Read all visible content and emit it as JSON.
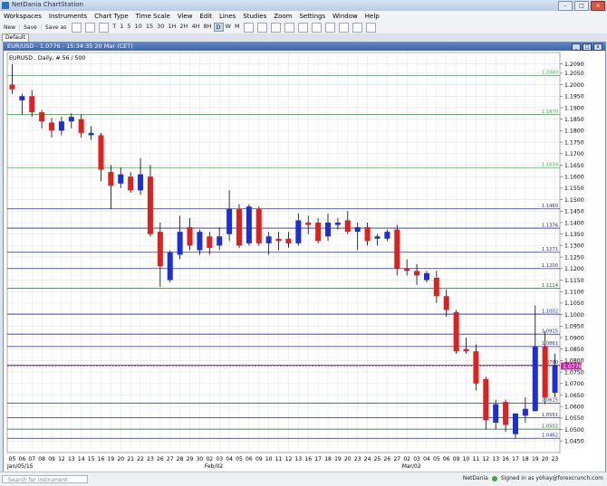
{
  "window": {
    "title": "NetDania ChartStation"
  },
  "menu": [
    "Workspaces",
    "Instruments",
    "Chart Type",
    "Time Scale",
    "View",
    "Edit",
    "Lines",
    "Studies",
    "Zoom",
    "Settings",
    "Window",
    "Help"
  ],
  "toolbar": {
    "new": "New",
    "save": "Save",
    "save_as": "Save as",
    "periods": [
      "T",
      "1",
      "5",
      "10",
      "15",
      "30",
      "1H",
      "2H",
      "4H",
      "8H",
      "D",
      "W",
      "M"
    ],
    "active_period": "D"
  },
  "tab": {
    "label": "Default"
  },
  "chart_window": {
    "title": "EUR/USD - 1.0776 - 15:34:35  20 Mar (CET)"
  },
  "chart_data": {
    "type": "candlestick",
    "label": "EURUSD , Daily, # 56 / 500",
    "ylim": [
      1.04,
      1.214
    ],
    "y_ticks": [
      "1.2090",
      "1.2050",
      "1.2000",
      "1.1950",
      "1.1900",
      "1.1850",
      "1.1800",
      "1.1750",
      "1.1700",
      "1.1650",
      "1.1600",
      "1.1550",
      "1.1500",
      "1.1450",
      "1.1400",
      "1.1350",
      "1.1300",
      "1.1250",
      "1.1200",
      "1.1150",
      "1.1100",
      "1.1050",
      "1.1000",
      "1.0950",
      "1.0900",
      "1.0850",
      "1.0800",
      "1.0750",
      "1.0700",
      "1.0650",
      "1.0600",
      "1.0550",
      "1.0500",
      "1.0450"
    ],
    "x_labels": [
      "05",
      "06",
      "07",
      "08",
      "09",
      "12",
      "13",
      "14",
      "15",
      "16",
      "19",
      "20",
      "21",
      "22",
      "23",
      "26",
      "27",
      "28",
      "29",
      "30",
      "02",
      "03",
      "04",
      "05",
      "06",
      "09",
      "10",
      "11",
      "12",
      "13",
      "16",
      "17",
      "18",
      "19",
      "20",
      "23",
      "24",
      "25",
      "26",
      "27",
      "02",
      "03",
      "04",
      "05",
      "06",
      "09",
      "10",
      "11",
      "12",
      "13",
      "16",
      "17",
      "18",
      "19",
      "20",
      "23"
    ],
    "month_labels": [
      {
        "index": 0,
        "text": "Jan/05/15"
      },
      {
        "index": 20,
        "text": "Feb/02"
      },
      {
        "index": 40,
        "text": "Mar/02"
      }
    ],
    "levels": [
      {
        "value": 1.204,
        "label": "1.2040",
        "color": "#2fb84a"
      },
      {
        "value": 1.187,
        "label": "1.1870",
        "color": "#2fb84a"
      },
      {
        "value": 1.1639,
        "label": "1.1639",
        "color": "#2fb84a"
      },
      {
        "value": 1.146,
        "label": "1.1460",
        "color": "#2a2a9e"
      },
      {
        "value": 1.1376,
        "label": "1.1376",
        "color": "#2a2a9e"
      },
      {
        "value": 1.1271,
        "label": "1.1271",
        "color": "#2a2a9e"
      },
      {
        "value": 1.12,
        "label": "1.1200",
        "color": "#2a2a9e"
      },
      {
        "value": 1.1114,
        "label": "1.1114",
        "color": "#1d6b3a"
      },
      {
        "value": 1.1002,
        "label": "1.1002",
        "color": "#2a2a9e"
      },
      {
        "value": 1.0915,
        "label": "1.0915",
        "color": "#2a2a9e"
      },
      {
        "value": 1.0861,
        "label": "1.0861",
        "color": "#2a2a9e"
      },
      {
        "value": 1.078,
        "label": "1.0780",
        "color": "#2a2a9e"
      },
      {
        "value": 1.0615,
        "label": "1.0615",
        "color": "#2a2a9e"
      },
      {
        "value": 1.0551,
        "label": "1.0551",
        "color": "#2a2a9e"
      },
      {
        "value": 1.0502,
        "label": "1.0502",
        "color": "#1d6b3a"
      },
      {
        "value": 1.0462,
        "label": "1.0462",
        "color": "#2a2a9e"
      }
    ],
    "last_price": {
      "value": 1.0776,
      "label": "1.0776",
      "color": "#c22ca0"
    },
    "colors": {
      "up": "#1c2fd4",
      "down": "#e0201c",
      "wick": "#000000",
      "grid": "#e4e4e4"
    },
    "candles": [
      [
        1.2,
        1.209,
        1.196,
        1.198
      ],
      [
        1.1932,
        1.196,
        1.187,
        1.195
      ],
      [
        1.195,
        1.1975,
        1.186,
        1.188
      ],
      [
        1.188,
        1.189,
        1.181,
        1.184
      ],
      [
        1.1835,
        1.1855,
        1.177,
        1.18
      ],
      [
        1.18,
        1.186,
        1.178,
        1.184
      ],
      [
        1.184,
        1.1875,
        1.181,
        1.186
      ],
      [
        1.185,
        1.187,
        1.177,
        1.179
      ],
      [
        1.178,
        1.182,
        1.176,
        1.179
      ],
      [
        1.178,
        1.179,
        1.158,
        1.163
      ],
      [
        1.162,
        1.165,
        1.146,
        1.156
      ],
      [
        1.157,
        1.164,
        1.155,
        1.161
      ],
      [
        1.16,
        1.162,
        1.153,
        1.154
      ],
      [
        1.154,
        1.168,
        1.152,
        1.161
      ],
      [
        1.16,
        1.165,
        1.134,
        1.135
      ],
      [
        1.136,
        1.14,
        1.112,
        1.121
      ],
      [
        1.115,
        1.128,
        1.114,
        1.127
      ],
      [
        1.126,
        1.143,
        1.124,
        1.136
      ],
      [
        1.138,
        1.142,
        1.128,
        1.13
      ],
      [
        1.128,
        1.137,
        1.126,
        1.136
      ],
      [
        1.134,
        1.136,
        1.126,
        1.129
      ],
      [
        1.13,
        1.138,
        1.128,
        1.134
      ],
      [
        1.135,
        1.154,
        1.132,
        1.146
      ],
      [
        1.146,
        1.148,
        1.129,
        1.13
      ],
      [
        1.131,
        1.148,
        1.13,
        1.147
      ],
      [
        1.146,
        1.147,
        1.13,
        1.131
      ],
      [
        1.131,
        1.136,
        1.126,
        1.134
      ],
      [
        1.133,
        1.136,
        1.128,
        1.132
      ],
      [
        1.133,
        1.136,
        1.129,
        1.131
      ],
      [
        1.131,
        1.144,
        1.13,
        1.141
      ],
      [
        1.14,
        1.143,
        1.135,
        1.139
      ],
      [
        1.14,
        1.142,
        1.131,
        1.132
      ],
      [
        1.134,
        1.144,
        1.132,
        1.14
      ],
      [
        1.139,
        1.142,
        1.137,
        1.14
      ],
      [
        1.141,
        1.145,
        1.135,
        1.136
      ],
      [
        1.136,
        1.14,
        1.128,
        1.138
      ],
      [
        1.138,
        1.14,
        1.13,
        1.132
      ],
      [
        1.133,
        1.135,
        1.13,
        1.134
      ],
      [
        1.133,
        1.137,
        1.132,
        1.136
      ],
      [
        1.137,
        1.139,
        1.117,
        1.12
      ],
      [
        1.12,
        1.124,
        1.117,
        1.119
      ],
      [
        1.119,
        1.122,
        1.113,
        1.117
      ],
      [
        1.115,
        1.119,
        1.114,
        1.118
      ],
      [
        1.116,
        1.119,
        1.105,
        1.108
      ],
      [
        1.108,
        1.111,
        1.099,
        1.102
      ],
      [
        1.101,
        1.102,
        1.083,
        1.084
      ],
      [
        1.085,
        1.09,
        1.083,
        1.084
      ],
      [
        1.084,
        1.087,
        1.067,
        1.07
      ],
      [
        1.072,
        1.073,
        1.05,
        1.054
      ],
      [
        1.053,
        1.063,
        1.05,
        1.061
      ],
      [
        1.062,
        1.063,
        1.049,
        1.052
      ],
      [
        1.048,
        1.057,
        1.046,
        1.057
      ],
      [
        1.056,
        1.064,
        1.053,
        1.059
      ],
      [
        1.058,
        1.104,
        1.058,
        1.086
      ],
      [
        1.086,
        1.093,
        1.061,
        1.064
      ],
      [
        1.066,
        1.083,
        1.064,
        1.078
      ]
    ]
  },
  "statusbar": {
    "search_placeholder": "Search for instrument",
    "brand": "NetDania",
    "signed_in": "Signed in as yohay@forexcrunch.com"
  }
}
